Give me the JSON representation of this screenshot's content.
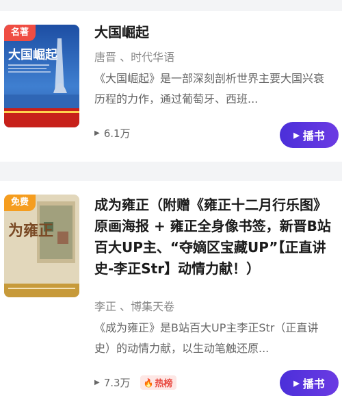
{
  "books": [
    {
      "badge": "名著",
      "cover_title": "大国崛起",
      "title": "大国崛起",
      "authors": "唐晋 、时代华语",
      "description": "《大国崛起》是一部深刻剖析世界主要大国兴衰历程的力作，通过葡萄牙、西班...",
      "plays": "6.1万",
      "button_label": "播书"
    },
    {
      "badge": "免费",
      "cover_title": "为雍正",
      "title": "成为雍正（附赠《雍正十二月行乐图》原画海报 + 雍正全身像书签，新晋B站百大UP主、“夺嫡区宝藏UP”【正直讲史-李正Str】动情力献！）",
      "authors": "李正 、博集天卷",
      "description": "《成为雍正》是B站百大UP主李正Str（正直讲史）的动情力献，以生动笔触还原...",
      "plays": "7.3万",
      "hot_label": "热榜",
      "button_label": "播书"
    }
  ],
  "colors": {
    "accent_button": "#5b35df",
    "badge_red": "#ef4d43",
    "badge_orange": "#f59d1f"
  }
}
